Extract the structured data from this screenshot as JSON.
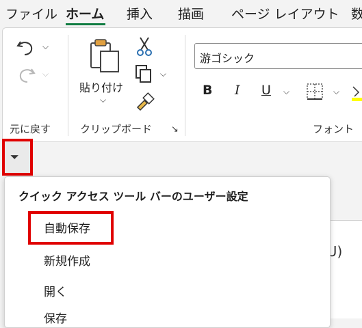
{
  "tabs": [
    {
      "label": "ファイル"
    },
    {
      "label": "ホーム",
      "active": true
    },
    {
      "label": "挿入"
    },
    {
      "label": "描画"
    },
    {
      "label": "ページ レイアウト"
    },
    {
      "label": "数"
    }
  ],
  "ribbon": {
    "undo_group_label": "元に戻す",
    "clipboard_label": "クリップボード",
    "paste_label": "貼り付け",
    "font_label": "フォント",
    "font_name": "游ゴシック",
    "bold": "B",
    "italic": "I",
    "underline": "U",
    "expander": "↘"
  },
  "qat": {
    "toggle_glyph": "⏷"
  },
  "menu": {
    "title": "クイック アクセス ツール バーのユーザー設定",
    "items": [
      {
        "label": "自動保存"
      },
      {
        "label": "新規作成"
      },
      {
        "label": "開く"
      },
      {
        "label": "保存"
      }
    ]
  },
  "sheet": {
    "peek_text": "(U)"
  },
  "colors": {
    "accent": "#107c41",
    "highlight": "#e00000"
  }
}
